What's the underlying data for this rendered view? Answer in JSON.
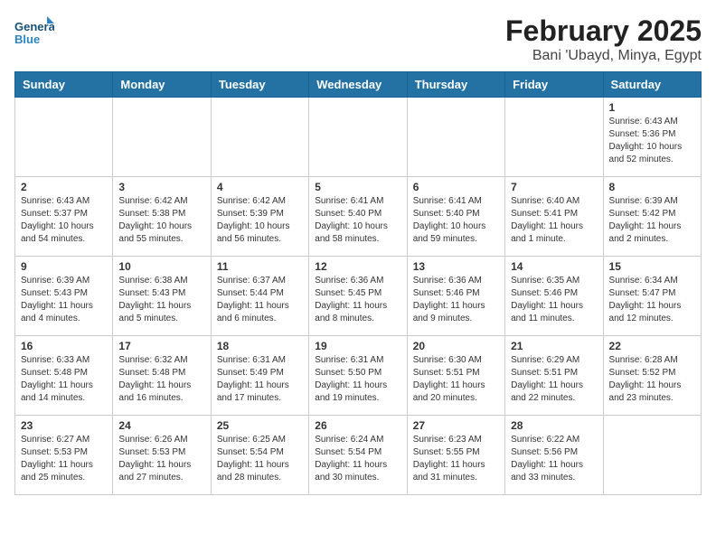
{
  "logo": {
    "text_general": "General",
    "text_blue": "Blue"
  },
  "title": "February 2025",
  "subtitle": "Bani 'Ubayd, Minya, Egypt",
  "days_of_week": [
    "Sunday",
    "Monday",
    "Tuesday",
    "Wednesday",
    "Thursday",
    "Friday",
    "Saturday"
  ],
  "weeks": [
    [
      {
        "day": "",
        "info": ""
      },
      {
        "day": "",
        "info": ""
      },
      {
        "day": "",
        "info": ""
      },
      {
        "day": "",
        "info": ""
      },
      {
        "day": "",
        "info": ""
      },
      {
        "day": "",
        "info": ""
      },
      {
        "day": "1",
        "info": "Sunrise: 6:43 AM\nSunset: 5:36 PM\nDaylight: 10 hours and 52 minutes."
      }
    ],
    [
      {
        "day": "2",
        "info": "Sunrise: 6:43 AM\nSunset: 5:37 PM\nDaylight: 10 hours and 54 minutes."
      },
      {
        "day": "3",
        "info": "Sunrise: 6:42 AM\nSunset: 5:38 PM\nDaylight: 10 hours and 55 minutes."
      },
      {
        "day": "4",
        "info": "Sunrise: 6:42 AM\nSunset: 5:39 PM\nDaylight: 10 hours and 56 minutes."
      },
      {
        "day": "5",
        "info": "Sunrise: 6:41 AM\nSunset: 5:40 PM\nDaylight: 10 hours and 58 minutes."
      },
      {
        "day": "6",
        "info": "Sunrise: 6:41 AM\nSunset: 5:40 PM\nDaylight: 10 hours and 59 minutes."
      },
      {
        "day": "7",
        "info": "Sunrise: 6:40 AM\nSunset: 5:41 PM\nDaylight: 11 hours and 1 minute."
      },
      {
        "day": "8",
        "info": "Sunrise: 6:39 AM\nSunset: 5:42 PM\nDaylight: 11 hours and 2 minutes."
      }
    ],
    [
      {
        "day": "9",
        "info": "Sunrise: 6:39 AM\nSunset: 5:43 PM\nDaylight: 11 hours and 4 minutes."
      },
      {
        "day": "10",
        "info": "Sunrise: 6:38 AM\nSunset: 5:43 PM\nDaylight: 11 hours and 5 minutes."
      },
      {
        "day": "11",
        "info": "Sunrise: 6:37 AM\nSunset: 5:44 PM\nDaylight: 11 hours and 6 minutes."
      },
      {
        "day": "12",
        "info": "Sunrise: 6:36 AM\nSunset: 5:45 PM\nDaylight: 11 hours and 8 minutes."
      },
      {
        "day": "13",
        "info": "Sunrise: 6:36 AM\nSunset: 5:46 PM\nDaylight: 11 hours and 9 minutes."
      },
      {
        "day": "14",
        "info": "Sunrise: 6:35 AM\nSunset: 5:46 PM\nDaylight: 11 hours and 11 minutes."
      },
      {
        "day": "15",
        "info": "Sunrise: 6:34 AM\nSunset: 5:47 PM\nDaylight: 11 hours and 12 minutes."
      }
    ],
    [
      {
        "day": "16",
        "info": "Sunrise: 6:33 AM\nSunset: 5:48 PM\nDaylight: 11 hours and 14 minutes."
      },
      {
        "day": "17",
        "info": "Sunrise: 6:32 AM\nSunset: 5:48 PM\nDaylight: 11 hours and 16 minutes."
      },
      {
        "day": "18",
        "info": "Sunrise: 6:31 AM\nSunset: 5:49 PM\nDaylight: 11 hours and 17 minutes."
      },
      {
        "day": "19",
        "info": "Sunrise: 6:31 AM\nSunset: 5:50 PM\nDaylight: 11 hours and 19 minutes."
      },
      {
        "day": "20",
        "info": "Sunrise: 6:30 AM\nSunset: 5:51 PM\nDaylight: 11 hours and 20 minutes."
      },
      {
        "day": "21",
        "info": "Sunrise: 6:29 AM\nSunset: 5:51 PM\nDaylight: 11 hours and 22 minutes."
      },
      {
        "day": "22",
        "info": "Sunrise: 6:28 AM\nSunset: 5:52 PM\nDaylight: 11 hours and 23 minutes."
      }
    ],
    [
      {
        "day": "23",
        "info": "Sunrise: 6:27 AM\nSunset: 5:53 PM\nDaylight: 11 hours and 25 minutes."
      },
      {
        "day": "24",
        "info": "Sunrise: 6:26 AM\nSunset: 5:53 PM\nDaylight: 11 hours and 27 minutes."
      },
      {
        "day": "25",
        "info": "Sunrise: 6:25 AM\nSunset: 5:54 PM\nDaylight: 11 hours and 28 minutes."
      },
      {
        "day": "26",
        "info": "Sunrise: 6:24 AM\nSunset: 5:54 PM\nDaylight: 11 hours and 30 minutes."
      },
      {
        "day": "27",
        "info": "Sunrise: 6:23 AM\nSunset: 5:55 PM\nDaylight: 11 hours and 31 minutes."
      },
      {
        "day": "28",
        "info": "Sunrise: 6:22 AM\nSunset: 5:56 PM\nDaylight: 11 hours and 33 minutes."
      },
      {
        "day": "",
        "info": ""
      }
    ]
  ]
}
